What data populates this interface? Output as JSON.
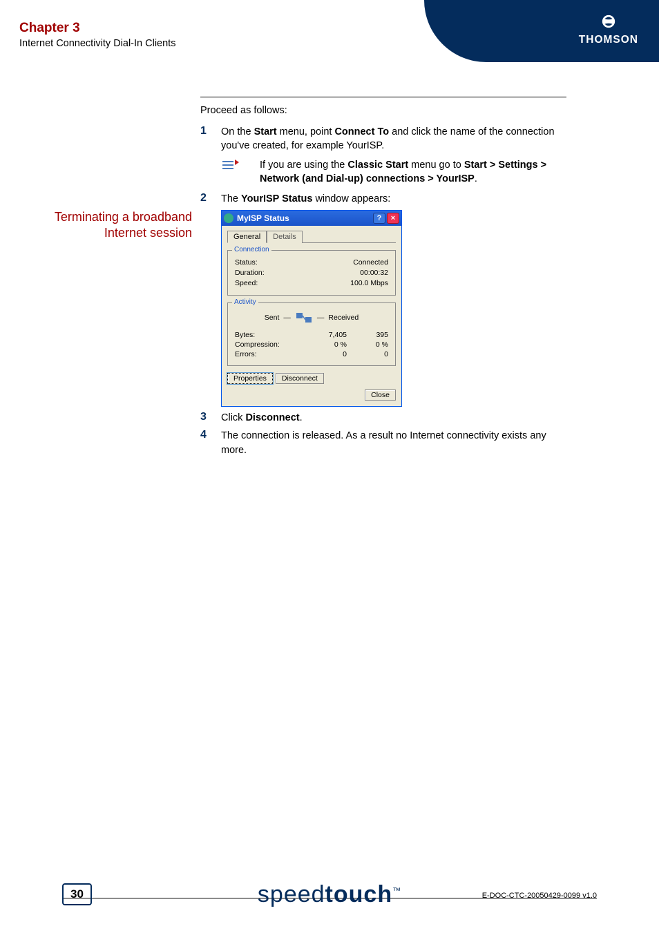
{
  "header": {
    "chapter": "Chapter 3",
    "subtitle": "Internet Connectivity Dial-In Clients",
    "brand": "THOMSON"
  },
  "section": {
    "sidecap": "Terminating a broadband Internet session",
    "lead": "Proceed as follows:"
  },
  "steps": {
    "s1": {
      "num": "1",
      "pre": "On the ",
      "b1": "Start",
      "mid1": " menu, point ",
      "b2": "Connect To",
      "post": " and click the name of the connection you've created, for example YourISP."
    },
    "note": {
      "pre": "If you are using the ",
      "b1": "Classic Start",
      "mid": " menu go to ",
      "b2": "Start > Settings > Network (and Dial-up) connections > YourISP",
      "post": "."
    },
    "s2": {
      "num": "2",
      "pre": "The ",
      "b1": "YourISP Status",
      "post": " window appears:"
    },
    "s3": {
      "num": "3",
      "pre": "Click ",
      "b1": "Disconnect",
      "post": "."
    },
    "s4": {
      "num": "4",
      "text": "The connection is released. As a result no Internet connectivity exists any more."
    }
  },
  "dialog": {
    "title": "MyISP Status",
    "help": "?",
    "close": "×",
    "tabs": {
      "general": "General",
      "details": "Details"
    },
    "group_connection": {
      "label": "Connection",
      "rows": {
        "status": {
          "k": "Status:",
          "v": "Connected"
        },
        "duration": {
          "k": "Duration:",
          "v": "00:00:32"
        },
        "speed": {
          "k": "Speed:",
          "v": "100.0 Mbps"
        }
      }
    },
    "group_activity": {
      "label": "Activity",
      "sent": "Sent",
      "received": "Received",
      "rows": {
        "bytes": {
          "k": "Bytes:",
          "s": "7,405",
          "r": "395"
        },
        "compression": {
          "k": "Compression:",
          "s": "0 %",
          "r": "0 %"
        },
        "errors": {
          "k": "Errors:",
          "s": "0",
          "r": "0"
        }
      }
    },
    "buttons": {
      "properties": "Properties",
      "disconnect": "Disconnect",
      "close_btn": "Close"
    }
  },
  "footer": {
    "page": "30",
    "logo_thin": "speed",
    "logo_bold": "touch",
    "tm": "™",
    "docid": "E-DOC-CTC-20050429-0099 v1.0"
  }
}
